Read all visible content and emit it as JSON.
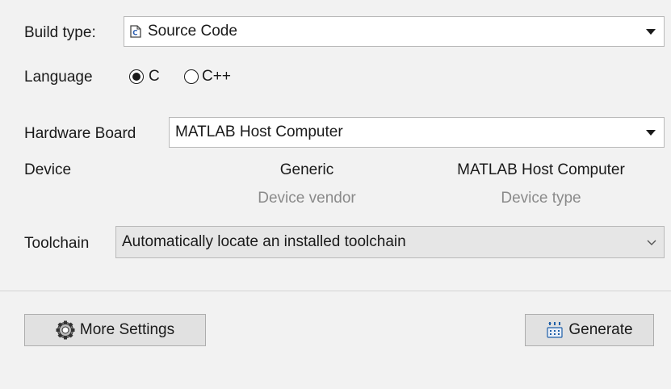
{
  "build": {
    "label": "Build type:",
    "value": "Source Code",
    "icon": "source-code-file-icon"
  },
  "language": {
    "label": "Language",
    "options": [
      "C",
      "C++"
    ],
    "selected": "C"
  },
  "hardware": {
    "label": "Hardware Board",
    "value": "MATLAB Host Computer"
  },
  "device": {
    "label": "Device",
    "vendor_value": "Generic",
    "vendor_caption": "Device vendor",
    "type_value": "MATLAB Host Computer",
    "type_caption": "Device type"
  },
  "toolchain": {
    "label": "Toolchain",
    "value": "Automatically locate an installed toolchain"
  },
  "buttons": {
    "more_settings": "More Settings",
    "more_settings_icon": "gear-icon",
    "generate": "Generate",
    "generate_icon": "generate-code-icon"
  }
}
